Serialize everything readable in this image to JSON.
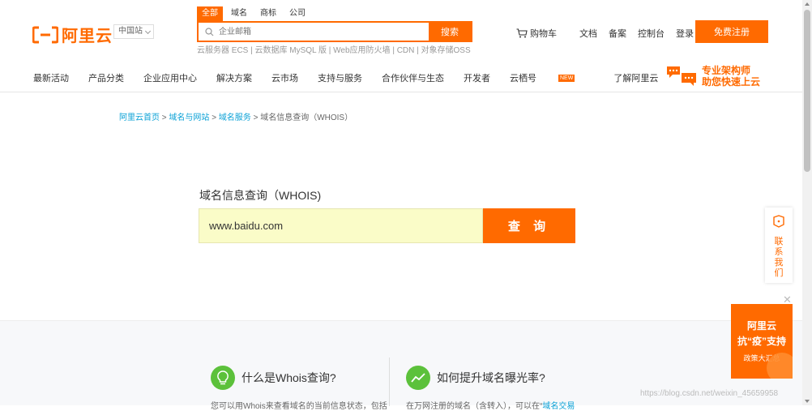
{
  "header": {
    "logo_text": "阿里云",
    "region": "中国站",
    "search_tabs": [
      "全部",
      "域名",
      "商标",
      "公司"
    ],
    "search_placeholder": "企业邮箱",
    "search_button": "搜索",
    "hot_links": "云服务器 ECS | 云数据库 MySQL 版 | Web应用防火墙 | CDN | 对象存储OSS",
    "cart": "购物车",
    "docs": "文档",
    "beian": "备案",
    "console": "控制台",
    "login": "登录",
    "register": "免费注册"
  },
  "nav": {
    "items": [
      "最新活动",
      "产品分类",
      "企业应用中心",
      "解决方案",
      "云市场",
      "支持与服务",
      "合作伙伴与生态",
      "开发者",
      "云栖号",
      "了解阿里云"
    ],
    "new_badge": "NEW",
    "architect_line1": "专业架构师",
    "architect_line2": "助您快速上云"
  },
  "breadcrumb": {
    "home": "阿里云首页",
    "sep": ">",
    "domains": "域名与网站",
    "domain_service": "域名服务",
    "current": "域名信息查询（WHOIS）"
  },
  "whois": {
    "title": "域名信息查询（WHOIS)",
    "value": "www.baidu.com",
    "button": "查 询"
  },
  "info": {
    "col1_title": "什么是Whois查询?",
    "col1_desc": "您可以用Whois来查看域名的当前信息状态，包括",
    "col2_title": "如何提升域名曝光率?",
    "col2_desc": "在万网注册的域名（含转入），可以在“",
    "col2_link": "域名交易"
  },
  "contact": {
    "label": "联系我们"
  },
  "promo": {
    "line1": "阿里云",
    "line2": "抗“疫”支持",
    "line3": "政策大汇总",
    "close": "✕"
  },
  "watermark": "https://blog.csdn.net/weixin_45659958",
  "colors": {
    "accent": "#ff6a00",
    "link": "#0aa1d6",
    "green": "#5cc13b"
  }
}
